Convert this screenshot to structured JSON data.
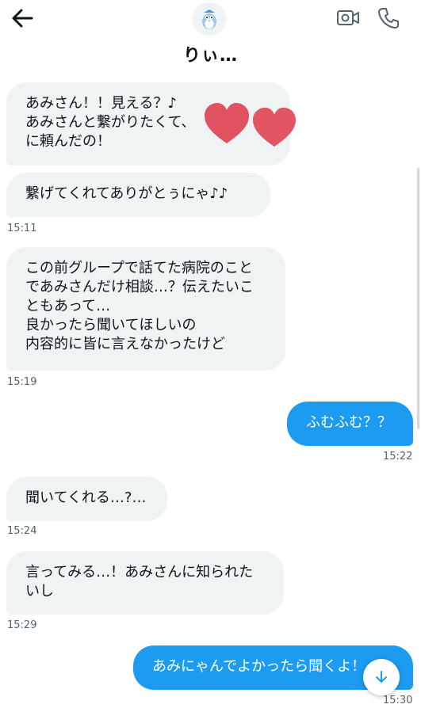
{
  "header": {
    "title": "りぃ…",
    "icons": {
      "back": "arrow-left-icon",
      "video": "video-camera-icon",
      "call": "phone-icon"
    }
  },
  "messages": [
    {
      "side": "in",
      "text": "あみさん！！見える？♪\nあみさんと繋がりたくて、　　　さ\nに頼んだの！"
    },
    {
      "side": "in",
      "text": "繋げてくれてありがとぅにゃ♪♪"
    },
    {
      "side": "in",
      "text": "この前グループで話てた病院のこと\nであみさんだけ相談…？伝えたいこ\nともあって…\n良かったら聞いてほしいの\n内容的に皆に言えなかったけど"
    },
    {
      "side": "out",
      "text": "ふむふむ？？"
    },
    {
      "side": "in",
      "text": "聞いてくれる…?…"
    },
    {
      "side": "in",
      "text": "言ってみる…！あみさんに知られた\nいし"
    },
    {
      "side": "out",
      "text": "あみにゃんでよかったら聞くよ！"
    }
  ],
  "timestamps": [
    "15:11",
    "15:19",
    "15:22",
    "15:24",
    "15:29",
    "15:30"
  ],
  "colors": {
    "outgoing": "#1d9bf0",
    "incoming": "#eff3f4",
    "heart": "#e0525f"
  },
  "scroll_button_icon": "arrow-down-icon"
}
